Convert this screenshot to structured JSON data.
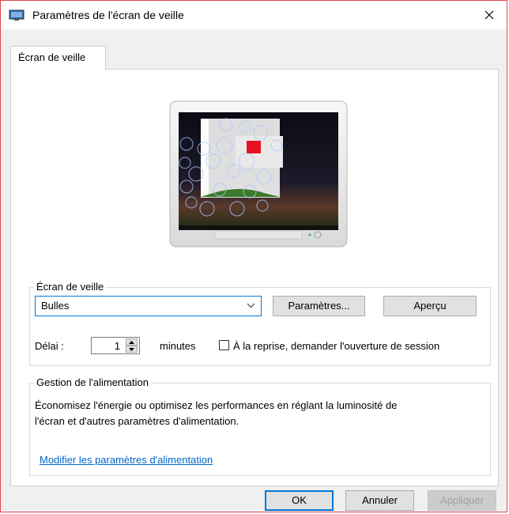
{
  "window": {
    "title": "Paramètres de l'écran de veille"
  },
  "tabs": [
    {
      "label": "Écran de veille"
    }
  ],
  "screensaver": {
    "group_label": "Écran de veille",
    "selected": "Bulles",
    "settings_button": "Paramètres...",
    "preview_button": "Aperçu",
    "delay_label": "Délai :",
    "delay_value": "1",
    "minutes_label": "minutes",
    "resume_checkbox_label": "À la reprise, demander l'ouverture de session",
    "resume_checked": false
  },
  "power": {
    "group_label": "Gestion de l'alimentation",
    "description_line1": "Économisez l'énergie ou optimisez les performances en réglant la luminosité de",
    "description_line2": "l'écran et d'autres paramètres d'alimentation.",
    "link": "Modifier les paramètres d'alimentation"
  },
  "footer": {
    "ok": "OK",
    "cancel": "Annuler",
    "apply": "Appliquer"
  },
  "colors": {
    "accent": "#0078d7",
    "link": "#0066cc",
    "window_border": "#e0464e"
  }
}
